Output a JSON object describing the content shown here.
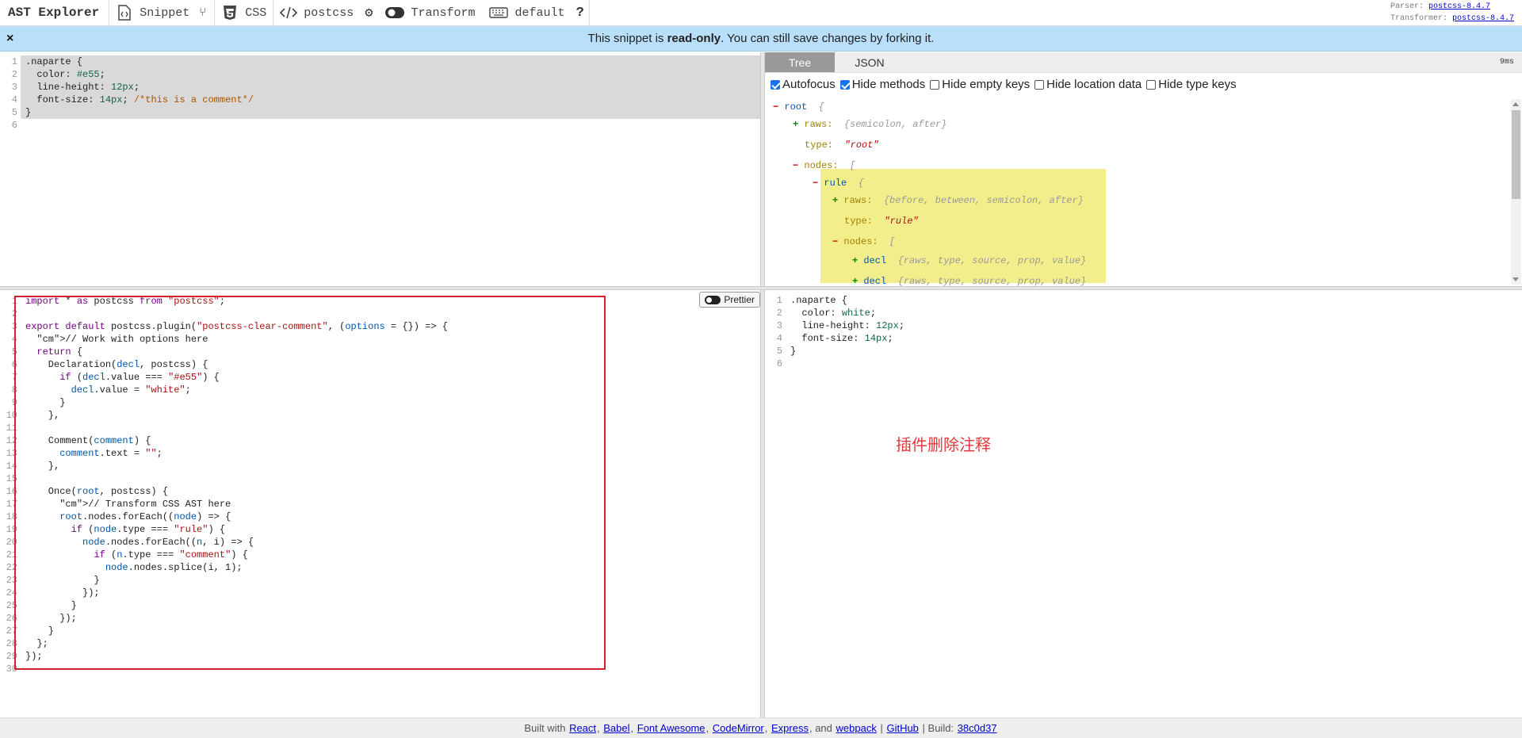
{
  "toolbar": {
    "brand": "AST Explorer",
    "snippet": "Snippet",
    "language": "CSS",
    "parser": "postcss",
    "transform": "Transform",
    "keymap": "default",
    "parser_version_label": "Parser:",
    "parser_version": "postcss-8.4.7",
    "transformer_version_label": "Transformer:",
    "transformer_version": "postcss-8.4.7"
  },
  "banner": {
    "close": "×",
    "prefix": "This snippet is ",
    "bold": "read-only",
    "suffix": ". You can still save changes by forking it."
  },
  "tree_pane": {
    "tabs": [
      "Tree",
      "JSON"
    ],
    "timing": "9ms",
    "options": [
      {
        "label": "Autofocus",
        "checked": true
      },
      {
        "label": "Hide methods",
        "checked": true
      },
      {
        "label": "Hide empty keys",
        "checked": false
      },
      {
        "label": "Hide location data",
        "checked": false
      },
      {
        "label": "Hide type keys",
        "checked": false
      }
    ],
    "nodes": [
      {
        "sign": "−",
        "key": "root",
        "summary": "{"
      },
      {
        "sign": "+",
        "key": "raws:",
        "summary": "{semicolon, after}"
      },
      {
        "sign": "",
        "key": "type:",
        "value": "\"root\""
      },
      {
        "sign": "−",
        "key": "nodes:",
        "summary": "["
      },
      {
        "sign": "−",
        "key": "rule",
        "summary": "{"
      },
      {
        "sign": "+",
        "key": "raws:",
        "summary": "{before, between, semicolon, after}"
      },
      {
        "sign": "",
        "key": "type:",
        "value": "\"rule\""
      },
      {
        "sign": "−",
        "key": "nodes:",
        "summary": "["
      },
      {
        "sign": "+",
        "key": "decl",
        "summary": "{raws, type, source, prop, value}"
      },
      {
        "sign": "+",
        "key": "decl",
        "summary": "{raws, type, source, prop, value}"
      }
    ]
  },
  "prettier_label": "Prettier",
  "annotation": "插件删除注释",
  "footer": {
    "built_with": "Built with",
    "links": [
      "React",
      "Babel",
      "Font Awesome",
      "CodeMirror",
      "Express"
    ],
    "and": "and",
    "webpack": "webpack",
    "github": "GitHub",
    "build_label": "Build:",
    "build": "38c0d37"
  },
  "source_code": [
    ".naparte {",
    "  color: #e55;",
    "  line-height: 12px;",
    "  font-size: 14px; /*this is a comment*/",
    "}",
    ""
  ],
  "transform_code": [
    "import * as postcss from \"postcss\";",
    "",
    "export default postcss.plugin(\"postcss-clear-comment\", (options = {}) => {",
    "  // Work with options here",
    "  return {",
    "    Declaration(decl, postcss) {",
    "      if (decl.value === \"#e55\") {",
    "        decl.value = \"white\";",
    "      }",
    "    },",
    "",
    "    Comment(comment) {",
    "      comment.text = \"\";",
    "    },",
    "",
    "    Once(root, postcss) {",
    "      // Transform CSS AST here",
    "      root.nodes.forEach((node) => {",
    "        if (node.type === \"rule\") {",
    "          node.nodes.forEach((n, i) => {",
    "            if (n.type === \"comment\") {",
    "              node.nodes.splice(i, 1);",
    "            }",
    "          });",
    "        }",
    "      });",
    "    }",
    "  };",
    "});",
    ""
  ],
  "output_code": [
    ".naparte {",
    "  color: white;",
    "  line-height: 12px;",
    "  font-size: 14px;",
    "}",
    ""
  ]
}
